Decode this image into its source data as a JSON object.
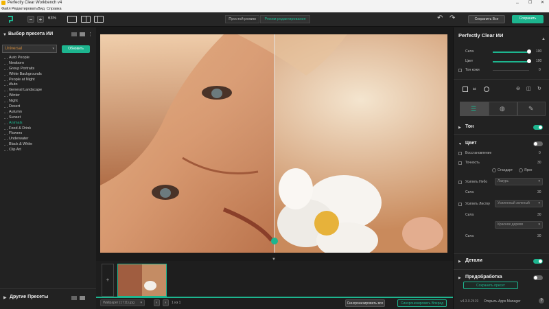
{
  "window": {
    "title": "Perfectly Clear Workbench v4"
  },
  "menu": [
    "Файл",
    "Редактировать",
    "Вид",
    "Справка"
  ],
  "toolbar": {
    "zoom": "63%",
    "mode_simple": "Простой режим",
    "mode_edit": "Режим редактирования",
    "save_all": "Сохранить Все",
    "save": "Сохранить"
  },
  "left": {
    "title": "Выбор пресета ИИ",
    "selected_preset": "Universal",
    "update_btn": "Обновить",
    "presets": [
      "Auto People",
      "Newborn",
      "Group Portraits",
      "White Backgrounds",
      "People at Night",
      "iAuto",
      "General Landscape",
      "Winter",
      "Night",
      "Desert",
      "Autumn",
      "Sunset",
      "Animals",
      "Food & Drink",
      "Flowers",
      "Underwater",
      "Black & White",
      "Clip Art"
    ],
    "other_presets": "Другие Пресеты"
  },
  "filmstrip": {
    "filename": "Wallpaper (1711).jpg",
    "counter": "1 из 1",
    "sync_all": "Синхронизировать все",
    "sync_forward": "Синхронизировать Вперед"
  },
  "right": {
    "title": "Perfectly Clear ИИ",
    "strength_label": "Сила",
    "strength_value": "100",
    "color_label": "Цвет",
    "color_value": "100",
    "skin_tone_label": "Тон кожи",
    "skin_tone_value": "0",
    "tone_section": "Тон",
    "color_section": "Цвет",
    "restore_label": "Восстановление",
    "restore_value": "0",
    "accuracy_label": "Точность",
    "accuracy_value": "30",
    "radio_standard": "Стандарт",
    "radio_bright": "Ярко",
    "enhance_sky_label": "Усилить Небо",
    "enhance_sky_value": "Лазурь",
    "sky_strength_label": "Сила",
    "sky_strength_value": "30",
    "enhance_foliage_label": "Усилить Листву",
    "enhance_foliage_value": "Усиленный зеленый",
    "foliage_strength_label": "Сила",
    "foliage_strength_value": "30",
    "red_wood_value": "Красное дерево",
    "red_strength_label": "Сила",
    "red_strength_value": "30",
    "details_section": "Детали",
    "preprocess_section": "Предобработка",
    "save_preset": "Сохранить пресет",
    "version": "v4.3.0.2419",
    "open_apps": "Открыть Apps Manager"
  },
  "colors": {
    "accent": "#1db58f"
  }
}
